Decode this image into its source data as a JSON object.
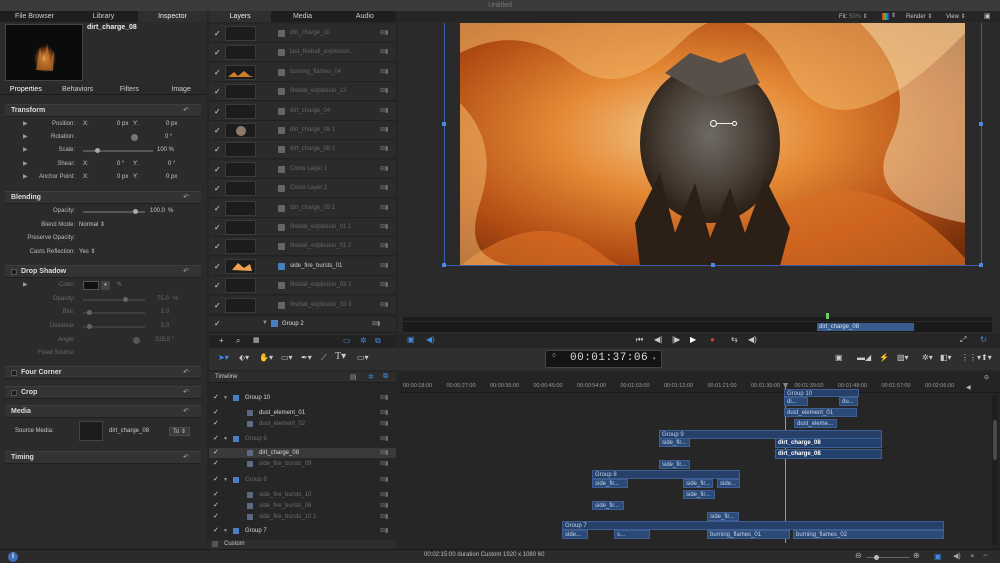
{
  "window_title": "Untitled",
  "left_tabs": [
    "File Browser",
    "Library",
    "Inspector"
  ],
  "left_active": 2,
  "preview": {
    "name": "dirt_charge_08"
  },
  "inspector_tabs": [
    "Properties",
    "Behaviors",
    "Filters",
    "Image"
  ],
  "sections": {
    "transform": "Transform",
    "blending": "Blending",
    "drop_shadow": "Drop Shadow",
    "four_corner": "Four Corner",
    "crop": "Crop",
    "media": "Media",
    "timing": "Timing"
  },
  "transform": {
    "position": {
      "label": "Position:",
      "x_label": "X:",
      "x": "0 px",
      "y_label": "Y:",
      "y": "0 px"
    },
    "rotation": {
      "label": "Rotation:",
      "value": "0 °"
    },
    "scale": {
      "label": "Scale:",
      "value": "100 %"
    },
    "shear": {
      "label": "Shear:",
      "x_label": "X:",
      "x": "0 °",
      "y_label": "Y:",
      "y": "0 °"
    },
    "anchor": {
      "label": "Anchor Point:",
      "x_label": "X:",
      "x": "0 px",
      "y_label": "Y:",
      "y": "0 px"
    }
  },
  "blending": {
    "opacity": {
      "label": "Opacity:",
      "value": "100.0",
      "unit": "%"
    },
    "blend_mode": {
      "label": "Blend Mode:",
      "value": "Normal"
    },
    "preserve": {
      "label": "Preserve Opacity:"
    },
    "casts": {
      "label": "Casts Reflection:",
      "value": "Yes"
    }
  },
  "drop_shadow": {
    "color": {
      "label": "Color:"
    },
    "opacity": {
      "label": "Opacity:",
      "value": "75.0",
      "unit": "%"
    },
    "blur": {
      "label": "Blur:",
      "value": "5.0"
    },
    "distance": {
      "label": "Distance:",
      "value": "5.0"
    },
    "angle": {
      "label": "Angle:",
      "value": "315.0 °"
    },
    "fixed": {
      "label": "Fixed Source:"
    }
  },
  "media": {
    "source_label": "Source Media:",
    "source_name": "dirt_charge_08",
    "to_label": "To"
  },
  "layers_tabs": [
    "Layers",
    "Media",
    "Audio"
  ],
  "layers": [
    {
      "name": "dirt_charge_10",
      "on": false,
      "type": "file"
    },
    {
      "name": "last_fireball_explosion...",
      "on": false,
      "type": "file"
    },
    {
      "name": "burning_flames_04",
      "on": false,
      "type": "file"
    },
    {
      "name": "fireball_explosion_12",
      "on": false,
      "type": "file"
    },
    {
      "name": "dirt_charge_04",
      "on": false,
      "type": "file"
    },
    {
      "name": "dirt_charge_08 1",
      "on": false,
      "type": "file"
    },
    {
      "name": "dirt_charge_08 2",
      "on": false,
      "type": "file"
    },
    {
      "name": "Clone Layer 1",
      "on": false,
      "type": "file"
    },
    {
      "name": "Clone Layer 2",
      "on": false,
      "type": "file"
    },
    {
      "name": "dirt_charge_05 1",
      "on": false,
      "type": "file"
    },
    {
      "name": "fireball_explosion_01 1",
      "on": false,
      "type": "file"
    },
    {
      "name": "fireball_explosion_01 2",
      "on": false,
      "type": "file"
    },
    {
      "name": "side_fire_bursts_01",
      "on": true,
      "type": "img"
    },
    {
      "name": "fireball_explosion_03 2",
      "on": false,
      "type": "file"
    },
    {
      "name": "fireball_explosion_03 3",
      "on": false,
      "type": "file"
    }
  ],
  "group2": "Group 2",
  "viewer": {
    "fit_label": "Fit:",
    "fit_value": "50%",
    "render": "Render",
    "view": "View",
    "mini_clip": "dirt_charge_08"
  },
  "timecode": "00:01:37:06",
  "timeline_label": "Timeline",
  "ruler": [
    "00:00:18:00",
    "00:00:27:00",
    "00:00:36:00",
    "00:00:45:00",
    "00:00:54:00",
    "00:01:03:00",
    "00:01:12:00",
    "00:01:21:00",
    "00:01:30:00",
    "00:01:39:00",
    "00:01:48:00",
    "00:01:57:00",
    "00:02:06:00"
  ],
  "tl_rows": [
    {
      "name": "Group 10",
      "group": true,
      "on": true
    },
    {
      "name": "dust_element_01",
      "group": false,
      "on": true
    },
    {
      "name": "dust_element_02",
      "group": false,
      "on": false
    },
    {
      "name": "Group 9",
      "group": true,
      "on": false
    },
    {
      "name": "dirt_charge_08",
      "group": false,
      "on": true,
      "sel": true
    },
    {
      "name": "side_fire_bursts_09",
      "group": false,
      "on": false
    },
    {
      "name": "Group 8",
      "group": true,
      "on": false
    },
    {
      "name": "side_fire_bursts_10",
      "group": false,
      "on": false
    },
    {
      "name": "side_fire_bursts_08",
      "group": false,
      "on": false
    },
    {
      "name": "side_fire_bursts_10 1",
      "group": false,
      "on": false
    },
    {
      "name": "Group 7",
      "group": true,
      "on": true
    }
  ],
  "clips": {
    "g10": "Group 10",
    "g10a": "di...",
    "g10b": "du...",
    "dust1": "dust_element_01",
    "dust2": "dust_eleme...",
    "g9": "Group 9",
    "sf1": "side_fir...",
    "dc1": "dirt_charge_08",
    "dc2": "dirt_charge_08",
    "sf2": "side_fir...",
    "g8": "Group 8",
    "sf3": "side_fir...",
    "sf4": "side_fir...",
    "sf5": "side...",
    "sf6": "side_fir...",
    "sf7": "side_fir...",
    "sf8": "side_fir...",
    "g7": "Group 7",
    "g7a": "side...",
    "g7b": "s...",
    "bf1": "burning_flames_01",
    "bf2": "burning_flames_02"
  },
  "custom_label": "Custom",
  "status": "00:02:15:00 duration Custom 1920 x 1080 60",
  "colors": {
    "accent": "#3d8ee8",
    "clip": "#2c4a78",
    "bg": "#262626"
  }
}
